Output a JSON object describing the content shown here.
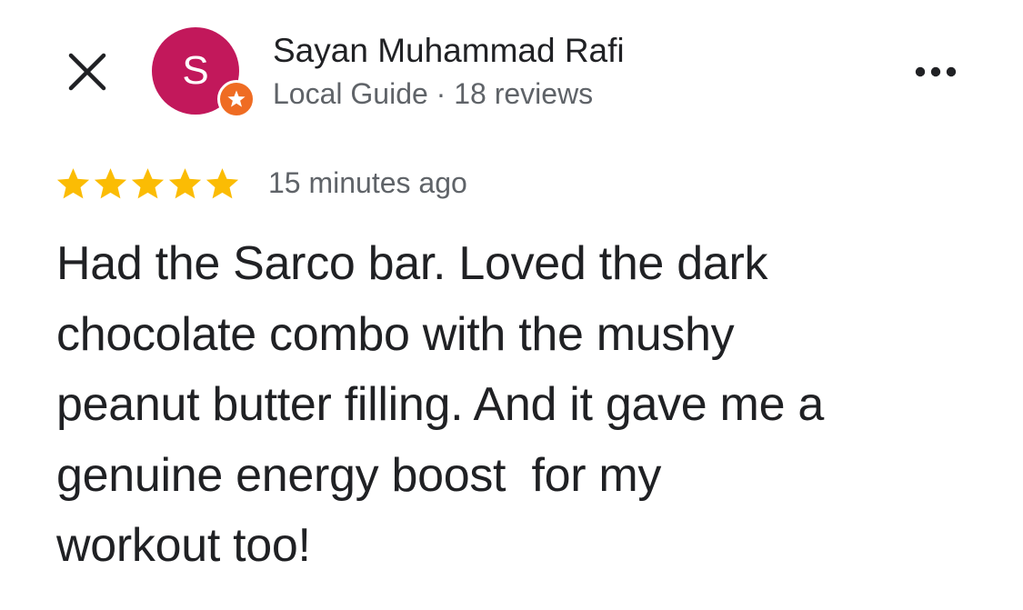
{
  "header": {
    "close_icon": "close-icon",
    "more_icon": "more-options-icon"
  },
  "reviewer": {
    "avatar_initial": "S",
    "avatar_color": "#c2185b",
    "badge_icon": "local-guide-star-icon",
    "badge_color": "#ef6c23",
    "name": "Sayan Muhammad Rafi",
    "meta": "Local Guide · 18 reviews"
  },
  "review": {
    "rating": 5,
    "rating_max": 5,
    "star_color": "#fbbc04",
    "timestamp": "15 minutes ago",
    "text_lines": [
      "Had the Sarco bar. Loved the dark",
      "chocolate combo with the mushy",
      "peanut butter filling. And it gave me a",
      "genuine energy boost  for my",
      "workout too!"
    ]
  }
}
